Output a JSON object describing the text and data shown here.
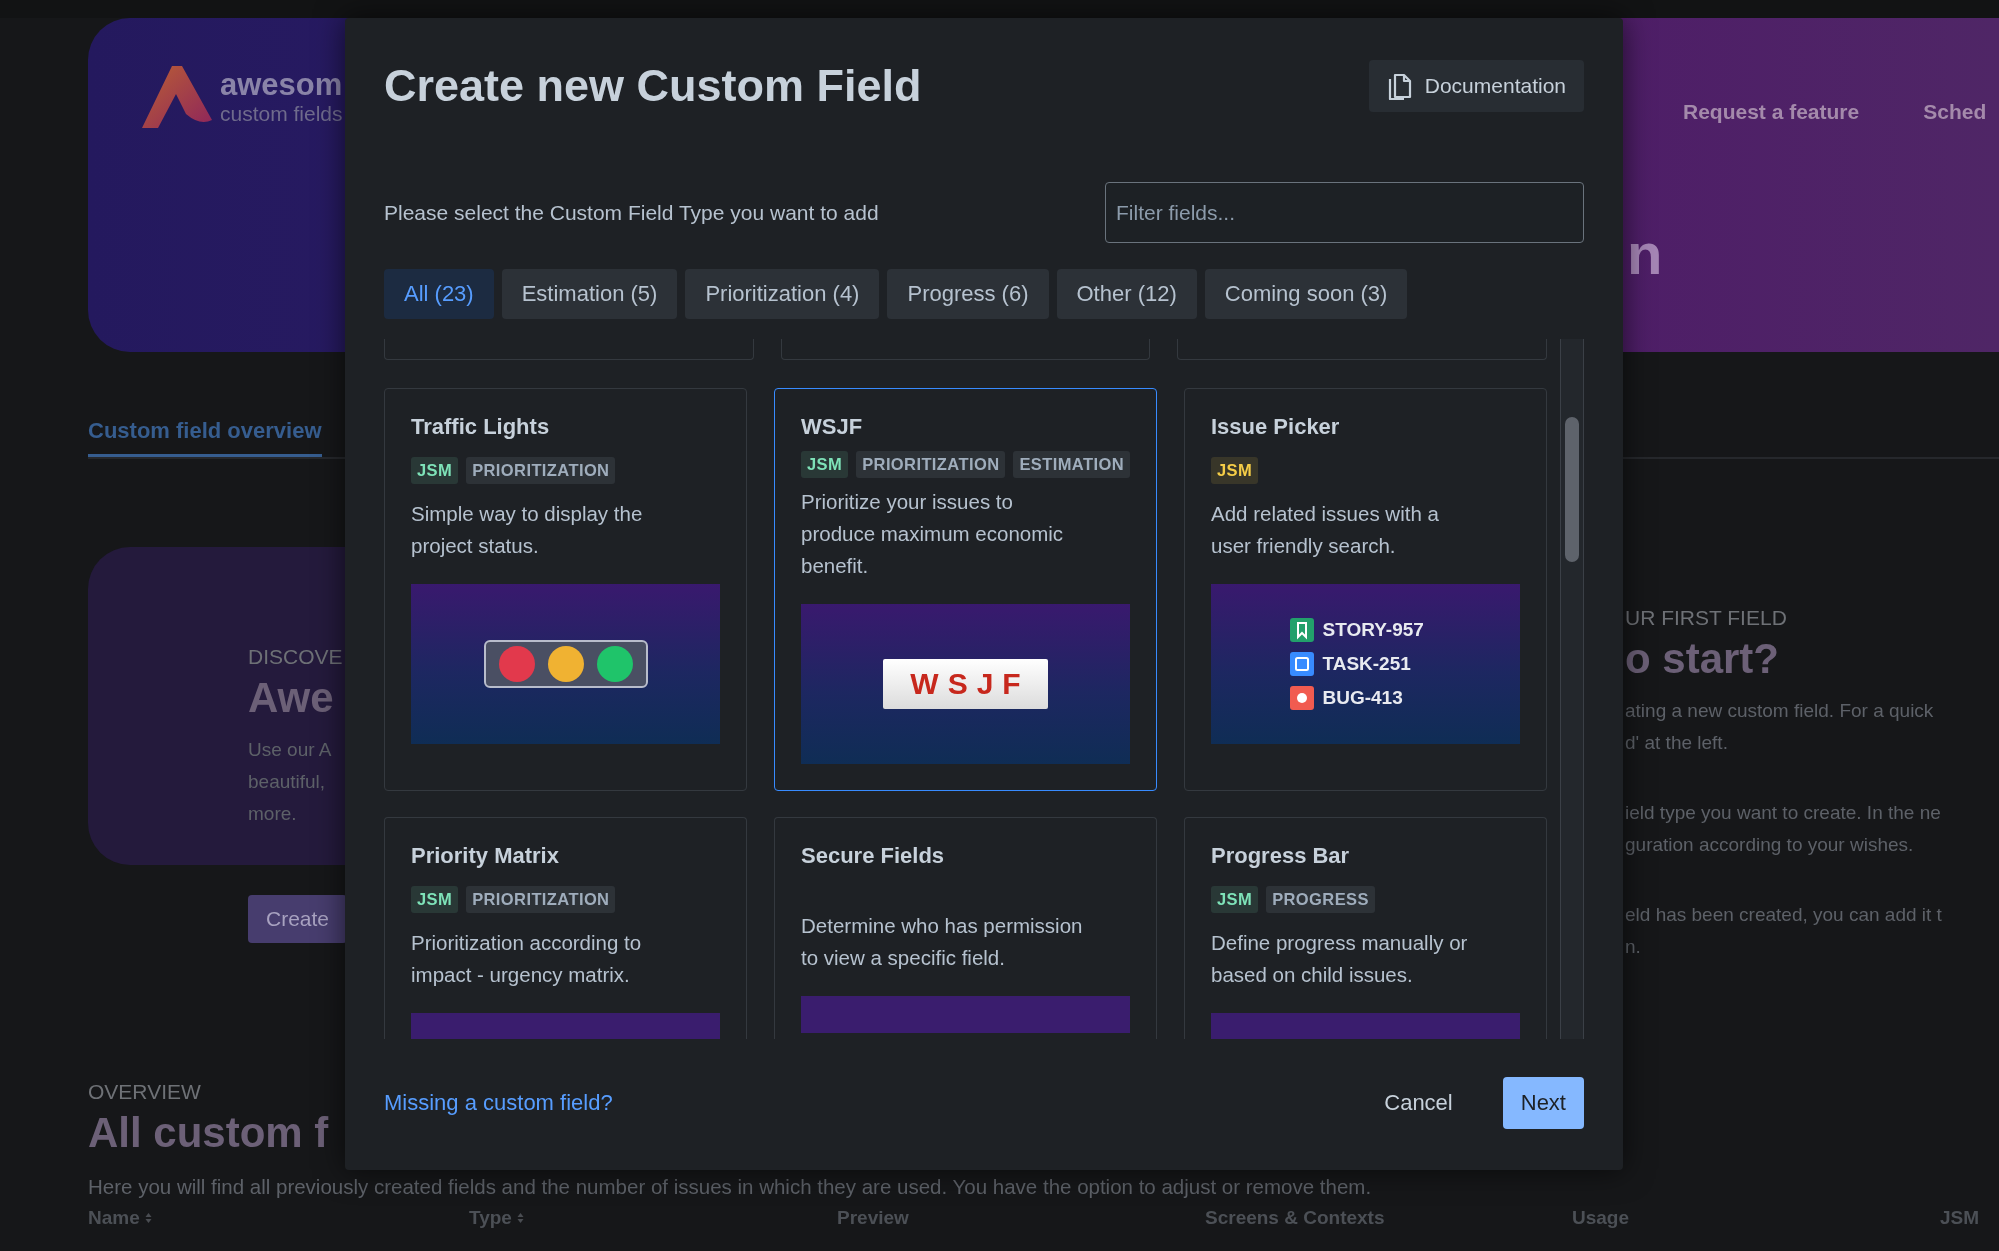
{
  "background": {
    "logo": {
      "name": "awesom",
      "tagline": "custom fields"
    },
    "nav_links": [
      "Request a feature",
      "Sched"
    ],
    "hero_title": "n",
    "tabs": [
      {
        "label": "Custom field overview",
        "selected": true
      }
    ],
    "discover": {
      "eyebrow": "DISCOVE",
      "title": "Awe",
      "lines": [
        "Use our A",
        "beautiful,",
        "more."
      ],
      "button": "Create"
    },
    "first_field": {
      "eyebrow": "UR FIRST FIELD",
      "title": "o start?",
      "paragraphs": [
        [
          "ating a new custom field. For a quick",
          "d' at the left."
        ],
        [
          "ield type you want to create. In the ne",
          "guration according to your wishes."
        ],
        [
          "eld has been created, you can add it t",
          "n."
        ]
      ]
    },
    "overview": {
      "eyebrow": "OVERVIEW",
      "title": "All custom f",
      "description": "Here you will find all previously created fields and the number of issues in which they are used. You have the option to adjust or remove them.",
      "columns": [
        {
          "label": "Name",
          "sortable": true
        },
        {
          "label": "Type",
          "sortable": true
        },
        {
          "label": "Preview",
          "sortable": false
        },
        {
          "label": "Screens & Contexts",
          "sortable": false
        },
        {
          "label": "Usage",
          "sortable": false
        },
        {
          "label": "JSM",
          "sortable": false
        }
      ]
    }
  },
  "dialog": {
    "title": "Create new Custom Field",
    "doc_button": "Documentation",
    "prompt": "Please select the Custom Field Type you want to add",
    "filter": {
      "placeholder": "Filter fields..."
    },
    "tabs": [
      {
        "label": "All (23)",
        "selected": true
      },
      {
        "label": "Estimation (5)",
        "selected": false
      },
      {
        "label": "Prioritization (4)",
        "selected": false
      },
      {
        "label": "Progress (6)",
        "selected": false
      },
      {
        "label": "Other (12)",
        "selected": false
      },
      {
        "label": "Coming soon (3)",
        "selected": false
      }
    ],
    "cards_above": [
      {
        "kind": "cut-card"
      },
      {
        "kind": "cut-card"
      },
      {
        "kind": "cut-card"
      }
    ],
    "cards": [
      {
        "title": "Traffic Lights",
        "selected": false,
        "tags": [
          {
            "label": "JSM",
            "color": "#7ee2b8"
          },
          {
            "label": "PRIORITIZATION",
            "color": "#9fadbc"
          }
        ],
        "description": "Simple way to display the project status.",
        "preview": {
          "kind": "traffic-lights"
        }
      },
      {
        "title": "WSJF",
        "selected": true,
        "tags": [
          {
            "label": "JSM",
            "color": "#7ee2b8"
          },
          {
            "label": "PRIORITIZATION",
            "color": "#9fadbc"
          },
          {
            "label": "ESTIMATION",
            "color": "#9fadbc"
          }
        ],
        "description": "Prioritize your issues to produce maximum economic benefit.",
        "preview": {
          "kind": "badge",
          "text": "WSJF"
        }
      },
      {
        "title": "Issue Picker",
        "selected": false,
        "tags": [
          {
            "label": "JSM",
            "color": "#f5cd47"
          }
        ],
        "description": "Add related issues with a user friendly search.",
        "preview": {
          "kind": "issue-list",
          "issues": [
            {
              "key": "STORY-957",
              "kind": "story"
            },
            {
              "key": "TASK-251",
              "kind": "task"
            },
            {
              "key": "BUG-413",
              "kind": "bug"
            }
          ]
        }
      },
      {
        "title": "Priority Matrix",
        "selected": false,
        "tags": [
          {
            "label": "JSM",
            "color": "#7ee2b8"
          },
          {
            "label": "PRIORITIZATION",
            "color": "#9fadbc"
          }
        ],
        "description": "Prioritization according to impact - urgency matrix.",
        "preview": {
          "kind": "strip"
        }
      },
      {
        "title": "Secure Fields",
        "selected": false,
        "description": "Determine who has permission to view a specific field.",
        "preview": {
          "kind": "strip"
        }
      },
      {
        "title": "Progress Bar",
        "selected": false,
        "tags": [
          {
            "label": "JSM",
            "color": "#7ee2b8"
          },
          {
            "label": "PROGRESS",
            "color": "#9fadbc"
          }
        ],
        "description": "Define progress manually or based on child issues.",
        "preview": {
          "kind": "strip"
        }
      }
    ],
    "missing_link": "Missing a custom field?",
    "buttons": [
      {
        "label": "Cancel",
        "kind": "subtle"
      },
      {
        "label": "Next",
        "kind": "primary"
      }
    ]
  }
}
